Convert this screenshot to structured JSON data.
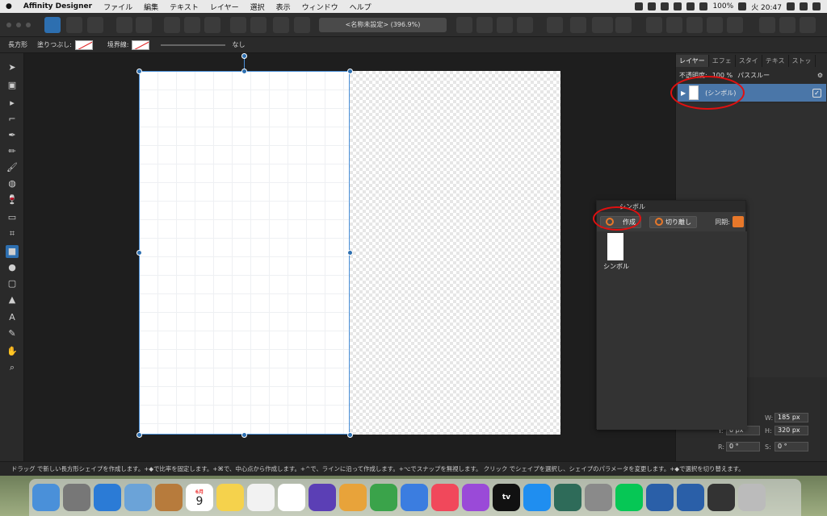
{
  "menubar": {
    "app_name": "Affinity Designer",
    "items": [
      "ファイル",
      "編集",
      "テキスト",
      "レイヤー",
      "選択",
      "表示",
      "ウィンドウ",
      "ヘルプ"
    ],
    "battery": "100%",
    "clock": "火 20:47"
  },
  "toolbar": {
    "doc_title": "<名称未設定> (396.9%)"
  },
  "context": {
    "tool_name": "長方形",
    "fill_label": "塗りつぶし:",
    "stroke_label": "境界線:",
    "stroke_value": "なし"
  },
  "layers_panel": {
    "tabs": [
      "レイヤー",
      "エフェ",
      "スタイ",
      "テキス",
      "ストッ"
    ],
    "opacity_label": "不透明度:",
    "opacity_value": "100 %",
    "blend_mode": "パススルー",
    "layer_name": "(シンボル)"
  },
  "transform": {
    "w_label": "W:",
    "w_value": "185 px",
    "h_label": "H:",
    "h_value": "320 px",
    "y_label": "Y:",
    "y_value": "0 px",
    "r_label": "R:",
    "r_value": "0 °",
    "s_label": "S:",
    "s_value": "0 °"
  },
  "symbols_panel": {
    "title": "シンボル",
    "create_label": "作成",
    "detach_label": "切り離し",
    "sync_label": "同期:",
    "item_label": "シンボル"
  },
  "status_bar": {
    "text": "ドラッグ で新しい長方形シェイプを作成します。+◆で比率を固定します。+⌘で、中心点から作成します。+^で、ラインに沿って作成します。+⌥でスナップを無視します。 クリック でシェイプを選択し、シェイプのパラメータを変更します。+◆で選択を切り替えます。"
  },
  "dock": {
    "calendar_month": "6月",
    "calendar_day": "9",
    "tv_label": "tv"
  },
  "colors": {
    "accent_blue": "#2d6fb0",
    "selection_blue": "#4a8fd8",
    "annotation_red": "#e01010",
    "symbol_orange": "#e8782a"
  }
}
